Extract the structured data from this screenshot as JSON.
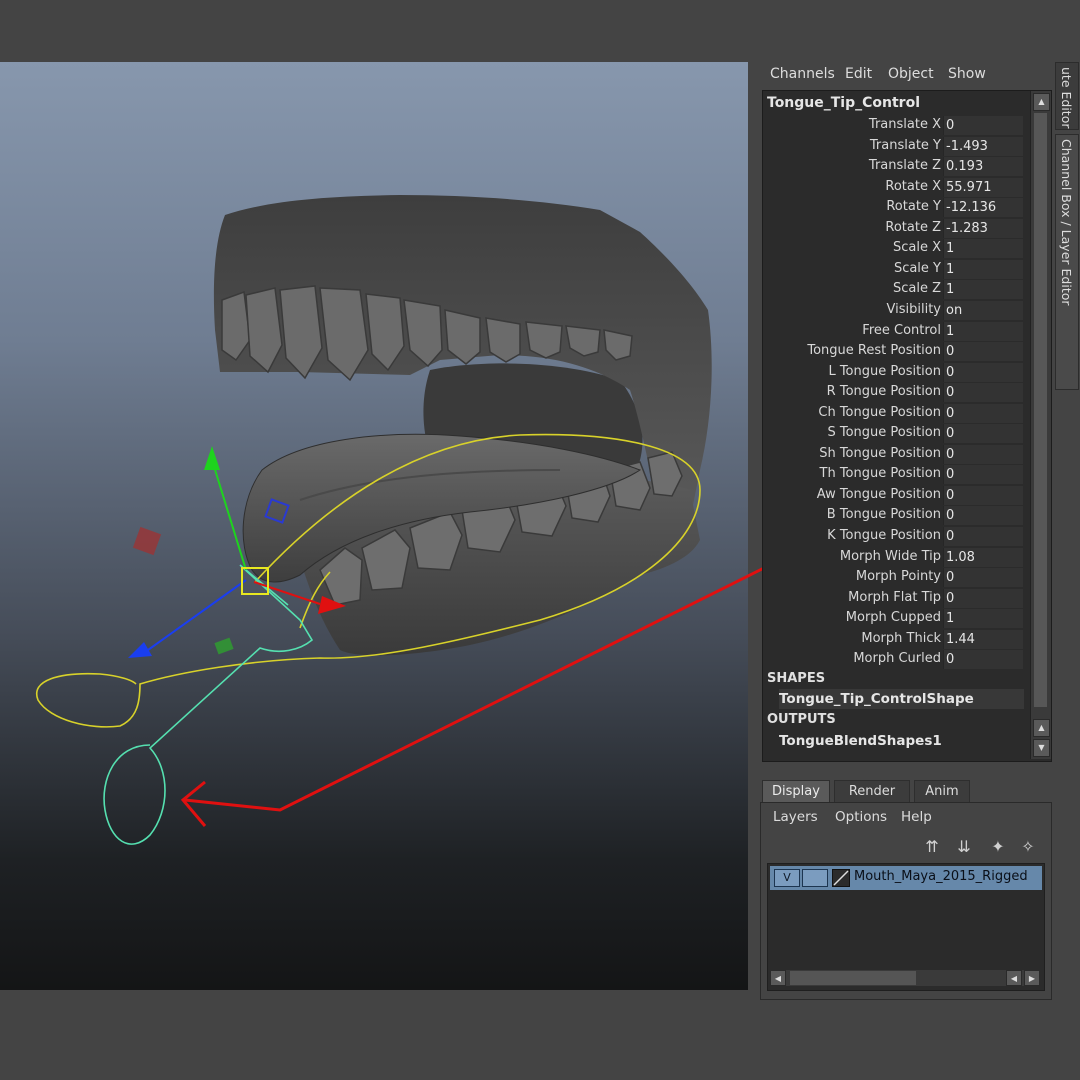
{
  "channel_box": {
    "menu": [
      "Channels",
      "Edit",
      "Object",
      "Show"
    ],
    "node_name": "Tongue_Tip_Control",
    "channels": [
      {
        "label": "Translate X",
        "value": "0"
      },
      {
        "label": "Translate Y",
        "value": "-1.493"
      },
      {
        "label": "Translate Z",
        "value": "0.193"
      },
      {
        "label": "Rotate X",
        "value": "55.971"
      },
      {
        "label": "Rotate Y",
        "value": "-12.136"
      },
      {
        "label": "Rotate Z",
        "value": "-1.283"
      },
      {
        "label": "Scale X",
        "value": "1"
      },
      {
        "label": "Scale Y",
        "value": "1"
      },
      {
        "label": "Scale Z",
        "value": "1"
      },
      {
        "label": "Visibility",
        "value": "on"
      },
      {
        "label": "Free Control",
        "value": "1"
      },
      {
        "label": "Tongue Rest Position",
        "value": "0"
      },
      {
        "label": "L Tongue Position",
        "value": "0"
      },
      {
        "label": "R Tongue Position",
        "value": "0"
      },
      {
        "label": "Ch Tongue Position",
        "value": "0"
      },
      {
        "label": "S Tongue Position",
        "value": "0"
      },
      {
        "label": "Sh Tongue Position",
        "value": "0"
      },
      {
        "label": "Th Tongue Position",
        "value": "0"
      },
      {
        "label": "Aw Tongue Position",
        "value": "0"
      },
      {
        "label": "B Tongue Position",
        "value": "0"
      },
      {
        "label": "K Tongue Position",
        "value": "0"
      },
      {
        "label": "Morph Wide Tip",
        "value": "1.08"
      },
      {
        "label": "Morph Pointy",
        "value": "0"
      },
      {
        "label": "Morph Flat Tip",
        "value": "0"
      },
      {
        "label": "Morph Cupped",
        "value": "1"
      },
      {
        "label": "Morph Thick",
        "value": "1.44"
      },
      {
        "label": "Morph Curled",
        "value": "0"
      }
    ],
    "shapes_header": "SHAPES",
    "shape_node": "Tongue_Tip_ControlShape",
    "outputs_header": "OUTPUTS",
    "output_node": "TongueBlendShapes1"
  },
  "side_tabs": {
    "attribute_editor": "ute Editor",
    "channel_box_layer_editor": "Channel Box / Layer Editor"
  },
  "layer_editor": {
    "tabs": [
      "Display",
      "Render",
      "Anim"
    ],
    "active_tab": "Display",
    "menu": [
      "Layers",
      "Options",
      "Help"
    ],
    "layer": {
      "visibility": "V",
      "name": "Mouth_Maya_2015_Rigged"
    }
  },
  "colors": {
    "highlight_box": "#e01010",
    "annotation_arrow": "#e01010",
    "curve_yellow": "#d8d22a",
    "curve_cyan": "#55e0b0",
    "layer_selected": "#6688aa"
  },
  "icons": [
    "move-layer-up-icon",
    "move-layer-down-icon",
    "create-empty-layer-icon",
    "create-layer-from-selected-icon"
  ]
}
